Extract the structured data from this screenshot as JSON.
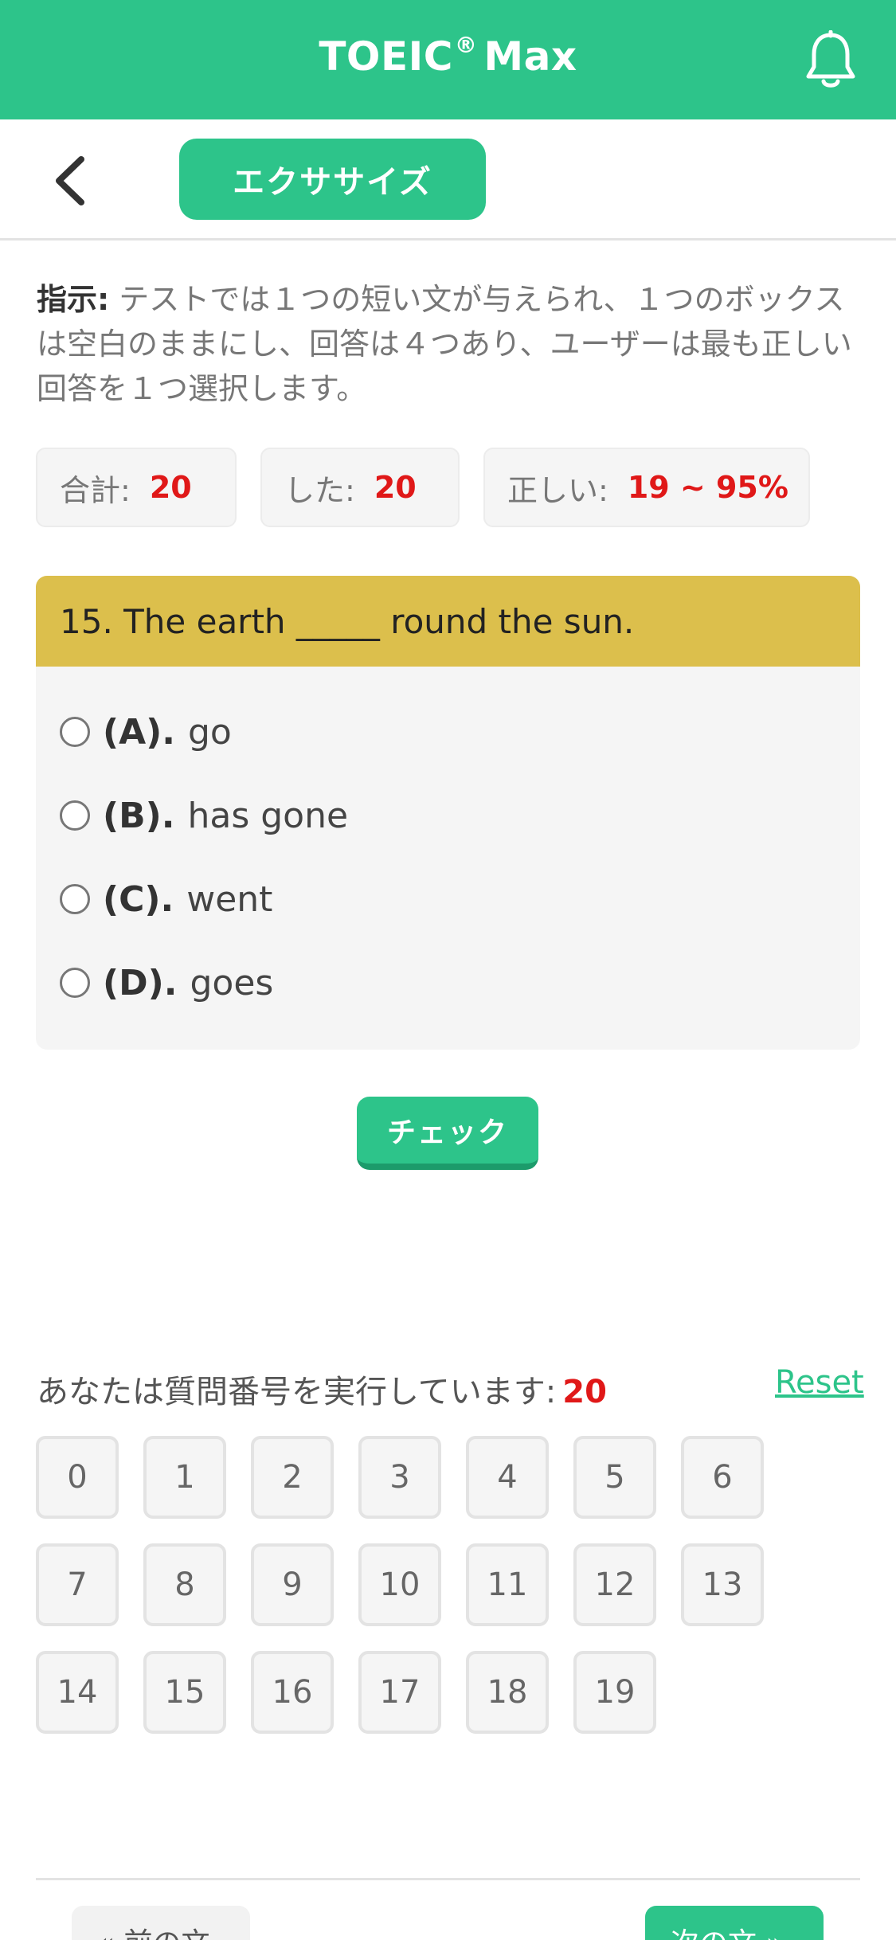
{
  "header": {
    "title": "TOEIC",
    "title_mark": "®",
    "title_suffix": "Max",
    "bell_icon": "bell-icon"
  },
  "nav": {
    "back_icon": "chevron-left-icon",
    "exercise_label": "エクササイズ"
  },
  "instructions": {
    "label": "指示:",
    "text": " テストでは１つの短い文が与えられ、１つのボックスは空白のままにし、回答は４つあり、ユーザーは最も正しい回答を１つ選択します。"
  },
  "stats": {
    "total_label": "合計:",
    "total_value": "20",
    "done_label": "した:",
    "done_value": "20",
    "correct_label": "正しい:",
    "correct_value": "19 ~ 95%"
  },
  "question": {
    "text": "15. The earth _____ round the sun.",
    "options": [
      {
        "letter": "(A).",
        "text": "go"
      },
      {
        "letter": "(B).",
        "text": "has gone"
      },
      {
        "letter": "(C).",
        "text": "went"
      },
      {
        "letter": "(D).",
        "text": "goes"
      }
    ],
    "check_label": "チェック"
  },
  "progress": {
    "label": "あなたは質問番号を実行しています:",
    "current": "20",
    "reset_label": "Reset",
    "numbers": [
      "0",
      "1",
      "2",
      "3",
      "4",
      "5",
      "6",
      "7",
      "8",
      "9",
      "10",
      "11",
      "12",
      "13",
      "14",
      "15",
      "16",
      "17",
      "18",
      "19"
    ]
  },
  "footer": {
    "prev_label": "« 前の文",
    "next_label": "次の文 »"
  },
  "colors": {
    "accent": "#2dc48a",
    "question_header": "#dcbf4c",
    "highlight": "#e01818"
  }
}
